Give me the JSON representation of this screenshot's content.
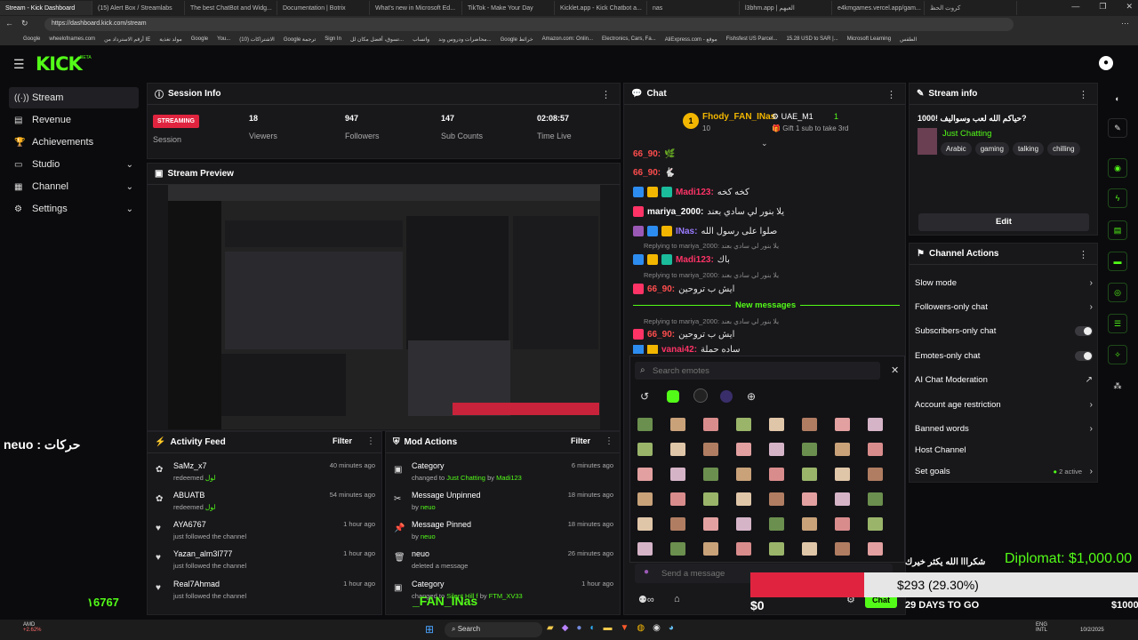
{
  "browser": {
    "tabs": [
      "Stream - Kick Dashboard",
      "(15) Alert Box / Streamlabs",
      "The best ChatBot and Widg...",
      "Documentation | Botrix",
      "What's new in Microsoft Ed...",
      "TikTok - Make Your Day",
      "Kicklet.app - Kick Chatbot a...",
      "nas",
      "l3bhm.app | العبهم",
      "e4kmgames.vercel.app/gam...",
      "كروت الحظ"
    ],
    "url": "https://dashboard.kick.com/stream",
    "bookmarks": [
      "Google",
      "wheelofnames.com",
      "أرقم الاسترداد من IE",
      "مولد تغذية",
      "Google",
      "You...",
      "(10) الاشتراكات",
      "Google ترجمة",
      "Sign In",
      "تسوق، أفضل مكان لل...",
      "واتساب",
      "محاضرات ودروس وند...",
      "Google خرائط",
      "Amazon.com: Onlin...",
      "Electronics, Cars, Fa...",
      "AliExpress.com - موقع",
      "Fishsfest US Parcel...",
      "15.28 USD to SAR |...",
      "Microsoft Learning",
      "الطقس"
    ]
  },
  "brand": {
    "logo": "KICK",
    "beta": "BETA"
  },
  "sidebar": {
    "items": [
      {
        "label": "Stream",
        "icon": "broadcast-icon"
      },
      {
        "label": "Revenue",
        "icon": "wallet-icon"
      },
      {
        "label": "Achievements",
        "icon": "trophy-icon"
      },
      {
        "label": "Studio",
        "icon": "monitor-icon"
      },
      {
        "label": "Channel",
        "icon": "calendar-icon"
      },
      {
        "label": "Settings",
        "icon": "gear-icon"
      }
    ]
  },
  "session": {
    "title": "Session Info",
    "status": "STREAMING",
    "status_label": "Session",
    "stats": [
      {
        "value": "18",
        "label": "Viewers"
      },
      {
        "value": "947",
        "label": "Followers"
      },
      {
        "value": "147",
        "label": "Sub Counts"
      },
      {
        "value": "02:08:57",
        "label": "Time Live"
      }
    ]
  },
  "preview": {
    "title": "Stream Preview"
  },
  "overlay": {
    "left_text": "neuo : حركات",
    "bottom_left": "۱6767",
    "diplomat": "Diplomat: $1,000.00",
    "goal_amount": "$293 (29.30%)",
    "goal_progress": 0.293,
    "zero": "$0",
    "days": "29 DAYS TO GO",
    "thanks": "شكرااا الله يكثر خيرك",
    "right_amount": "$1000",
    "chat_user": "_FAN_INas"
  },
  "activity": {
    "title": "Activity Feed",
    "filter": "Filter",
    "items": [
      {
        "name": "SaMz_x7",
        "sub": "redeemed",
        "extra": "لول",
        "time": "40 minutes ago"
      },
      {
        "name": "ABUATB",
        "sub": "redeemed",
        "extra": "لول",
        "time": "54 minutes ago"
      },
      {
        "name": "AYA6767",
        "sub": "just followed the channel",
        "extra": "",
        "time": "1 hour ago"
      },
      {
        "name": "Yazan_alm3l777",
        "sub": "just followed the channel",
        "extra": "",
        "time": "1 hour ago"
      },
      {
        "name": "Real7Ahmad",
        "sub": "just followed the channel",
        "extra": "",
        "time": "1 hour ago"
      }
    ]
  },
  "mod": {
    "title": "Mod Actions",
    "filter": "Filter",
    "items": [
      {
        "name": "Category",
        "sub": "changed to ",
        "hl": "Just Chatting",
        "by": " by ",
        "user": "Madi123",
        "time": "6 minutes ago"
      },
      {
        "name": "Message Unpinned",
        "sub": "by ",
        "hl": "",
        "by": "",
        "user": "neuo",
        "time": "18 minutes ago"
      },
      {
        "name": "Message Pinned",
        "sub": "by ",
        "hl": "",
        "by": "",
        "user": "neuo",
        "time": "18 minutes ago"
      },
      {
        "name": "neuo",
        "sub": "deleted a message",
        "hl": "",
        "by": "",
        "user": "",
        "time": "26 minutes ago"
      },
      {
        "name": "Category",
        "sub": "changed to ",
        "hl": "Silent Hill f",
        "by": " by ",
        "user": "FTM_XV33",
        "time": "1 hour ago"
      }
    ]
  },
  "chat": {
    "title": "Chat",
    "pinned_user": "Fhody_FAN_INas",
    "pinned_count": "10",
    "pinned_rank": "1",
    "gift_user": "UAE_M1",
    "gift_count": "1",
    "gift_text": "Gift 1 sub to take 3rd",
    "lines": [
      {
        "user": "66_90:",
        "color": "#ff4d4d",
        "msg": "🌿"
      },
      {
        "user": "66_90:",
        "color": "#ff4d4d",
        "msg": "🐇"
      },
      {
        "user": "Madi123:",
        "color": "#ff3366",
        "msg": "كخه كخه"
      },
      {
        "user": "mariya_2000:",
        "color": "#ffffff",
        "msg": "يلا بنور لي سادي بعند"
      },
      {
        "user": "INas:",
        "color": "#9b7bff",
        "msg": "صلوا على رسول الله"
      },
      {
        "user": "Madi123:",
        "color": "#ff3366",
        "msg": "باك"
      },
      {
        "user": "66_90:",
        "color": "#ff4d4d",
        "msg": "ايش ب تروحين"
      },
      {
        "user": "66_90:",
        "color": "#ff4d4d",
        "msg": "ايش ب تروحين"
      },
      {
        "user": "vanai42:",
        "color": "#ff3366",
        "msg": "ساده حملة"
      }
    ],
    "replies": [
      "Replying to mariya_2000: يلا بنور لي سادي بعند",
      "Replying to mariya_2000: يلا بنور لي سادي بعند",
      "Replying to mariya_2000: يلا بنور لي سادي بعند"
    ],
    "new_messages": "New messages",
    "emote_search_placeholder": "Search emotes",
    "send_placeholder": "Send a message",
    "chat_button": "Chat"
  },
  "stream_info": {
    "title": "Stream info",
    "stream_title": "حياكم الله لعب وسواليف !1000?",
    "category": "Just Chatting",
    "tags": [
      "Arabic",
      "gaming",
      "talking",
      "chilling"
    ],
    "edit": "Edit"
  },
  "channel_actions": {
    "title": "Channel Actions",
    "items": [
      {
        "label": "Slow mode",
        "kind": "arrow"
      },
      {
        "label": "Followers-only chat",
        "kind": "arrow"
      },
      {
        "label": "Subscribers-only chat",
        "kind": "toggle"
      },
      {
        "label": "Emotes-only chat",
        "kind": "toggle"
      },
      {
        "label": "AI Chat Moderation",
        "kind": "external"
      },
      {
        "label": "Account age restriction",
        "kind": "arrow"
      },
      {
        "label": "Banned words",
        "kind": "arrow"
      },
      {
        "label": "Host Channel",
        "kind": "none"
      },
      {
        "label": "Set goals",
        "kind": "arrow",
        "note": "2 active"
      }
    ]
  },
  "taskbar": {
    "search": "Search",
    "weather": "AMD",
    "weather_sub": "+2.62%",
    "lang": "ENG",
    "lang2": "INTL",
    "time": "10/2/2025"
  },
  "colors": {
    "accent": "#53fc18",
    "live": "#e0243f",
    "panel": "#18181b"
  }
}
